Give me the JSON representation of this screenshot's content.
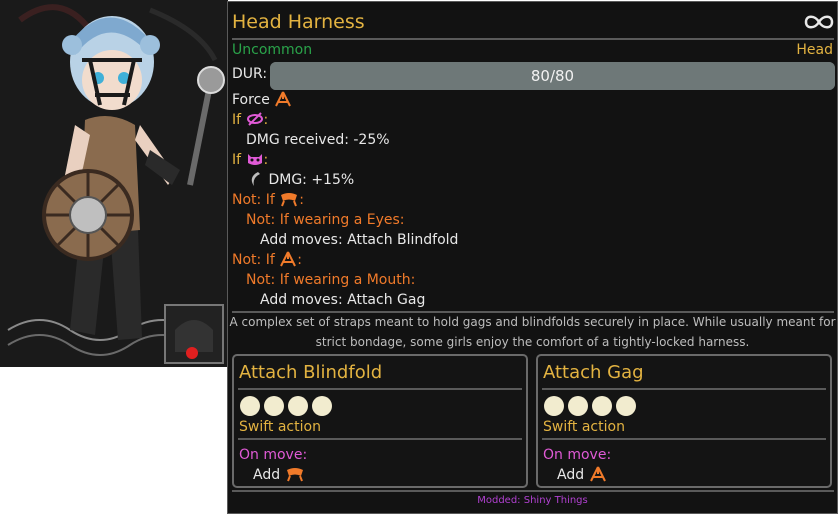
{
  "item": {
    "name": "Head Harness",
    "rarity": "Uncommon",
    "slot": "Head",
    "durability": {
      "label": "DUR:",
      "current": 80,
      "max": 80,
      "text": "80/80"
    },
    "stat_force": "Force",
    "conditions": [
      {
        "prefix": "If",
        "suffix": ":",
        "icon": "eye-crossed-icon",
        "effect": "DMG received: -25%"
      },
      {
        "prefix": "If",
        "suffix": ":",
        "icon": "monster-face-icon",
        "effect": "DMG: +15%"
      },
      {
        "prefix": "Not: If",
        "suffix": ":",
        "icon": "blindfold-icon",
        "sub": "Not: If wearing a Eyes:",
        "effect": "Add moves: Attach Blindfold"
      },
      {
        "prefix": "Not: If",
        "suffix": ":",
        "icon": "gag-icon",
        "sub": "Not: If wearing a Mouth:",
        "effect": "Add moves: Attach Gag"
      }
    ],
    "description_line1": "A complex set of straps meant to hold gags and blindfolds securely in place. While usually meant for",
    "description_line2": "strict bondage, some girls enjoy the comfort of a tightly-locked harness.",
    "mod_source": "Modded: Shiny Things"
  },
  "moves": [
    {
      "name": "Attach Blindfold",
      "pips": 4,
      "action": "Swift action",
      "trigger": "On move:",
      "effect": "Add",
      "effect_icon": "blindfold-icon"
    },
    {
      "name": "Attach Gag",
      "pips": 4,
      "action": "Swift action",
      "trigger": "On move:",
      "effect": "Add",
      "effect_icon": "gag-icon"
    }
  ],
  "icons": {
    "infinity": "infinity-icon"
  },
  "colors": {
    "name": "#e3b341",
    "rarity": "#2aa34a",
    "negation": "#f07a2a",
    "condition": "#e3b341",
    "trigger": "#e05ad6",
    "mod": "#b040d0"
  }
}
